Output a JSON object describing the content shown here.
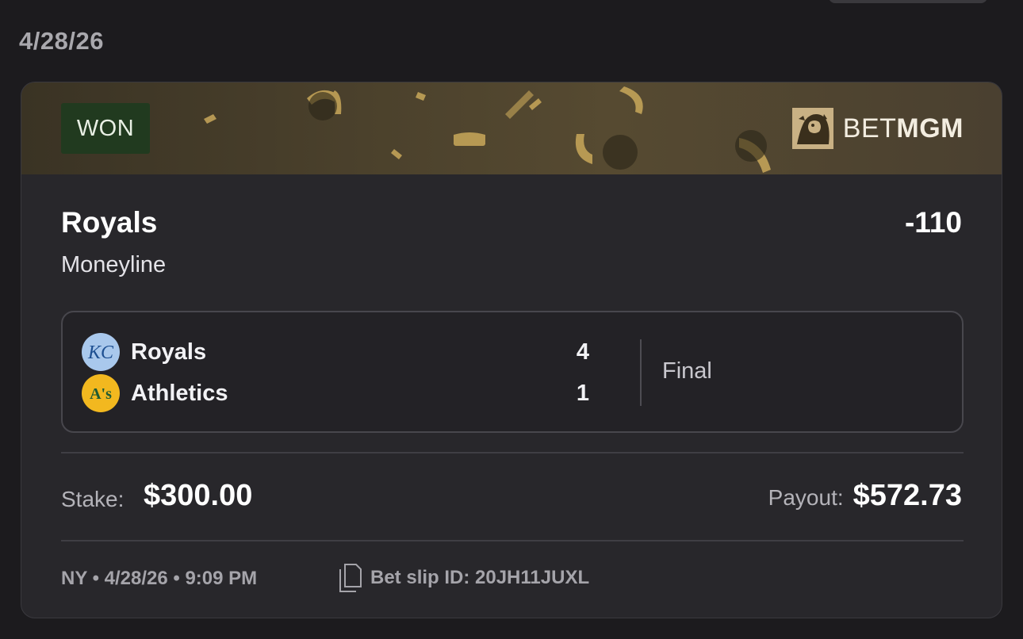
{
  "date_header": "4/28/26",
  "bet": {
    "status": "WON",
    "brand": {
      "prefix": "BET",
      "suffix": "MGM"
    },
    "selection": "Royals",
    "odds": "-110",
    "market": "Moneyline",
    "game": {
      "teams": [
        {
          "name": "Royals",
          "score": "4",
          "logo": "kc-royals-logo"
        },
        {
          "name": "Athletics",
          "score": "1",
          "logo": "athletics-logo"
        }
      ],
      "status": "Final"
    },
    "stake_label": "Stake:",
    "stake": "$300.00",
    "payout_label": "Payout:",
    "payout": "$572.73",
    "meta": "NY • 4/28/26 • 9:09 PM",
    "slip_id_text": "Bet slip ID: 20JH11JUXL"
  },
  "colors": {
    "background": "#1c1b1e",
    "card": "#28272b",
    "won_badge": "#213a1f",
    "banner_gold": "#564a31",
    "royals_blue": "#a9c8ec",
    "athletics_yellow": "#f2b81f",
    "athletics_green": "#1f5a32"
  }
}
